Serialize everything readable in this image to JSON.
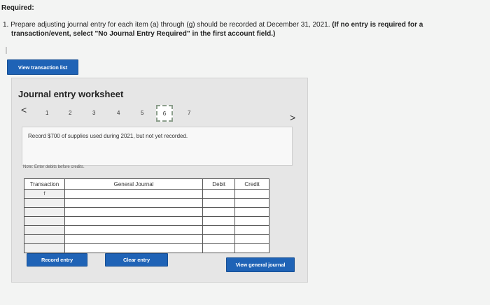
{
  "header": {
    "required_label": "Required:",
    "instruction_line1_plain": "1. Prepare adjusting journal entry for each item (a) through (g) should be recorded at December 31, 2021.",
    "instruction_line1_bold": "(If no entry is required for a",
    "instruction_line2": "transaction/event, select \"No Journal Entry Required\" in the first account field.)"
  },
  "buttons": {
    "view_transaction_list": "View transaction list",
    "record_entry": "Record entry",
    "clear_entry": "Clear entry",
    "view_general_journal": "View general journal"
  },
  "worksheet": {
    "title": "Journal entry worksheet",
    "steps": [
      "1",
      "2",
      "3",
      "4",
      "5",
      "6",
      "7"
    ],
    "active_step": "6",
    "description": "Record $700 of supplies used during 2021, but not yet recorded.",
    "note": "Note: Enter debits before credits."
  },
  "journal_table": {
    "headers": {
      "transaction": "Transaction",
      "general_journal": "General Journal",
      "debit": "Debit",
      "credit": "Credit"
    },
    "first_transaction": "f"
  },
  "colors": {
    "button_blue": "#1f63b6",
    "panel_gray": "#e6e6e6"
  },
  "icons": {
    "prev": "chevron-left-icon",
    "next": "chevron-right-icon"
  }
}
